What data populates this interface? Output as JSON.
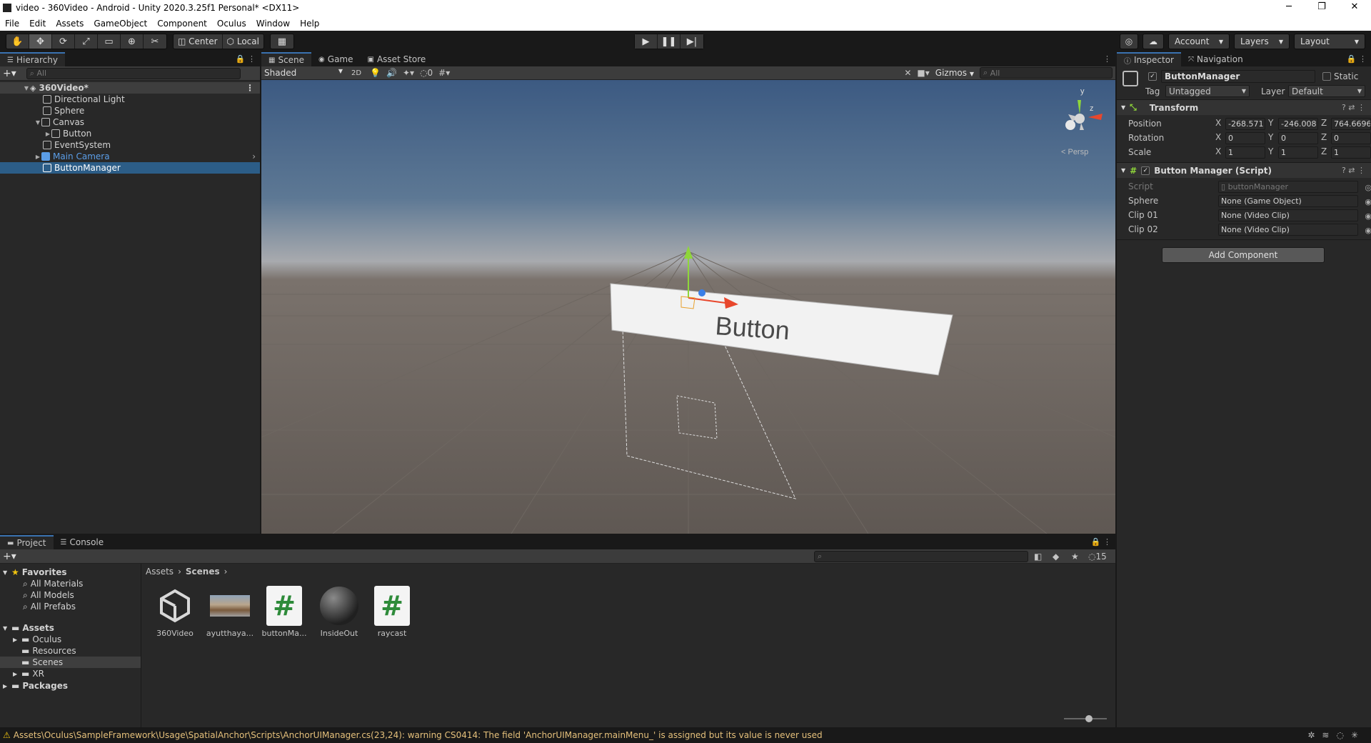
{
  "window": {
    "title": "video - 360Video - Android - Unity 2020.3.25f1 Personal* <DX11>",
    "minimize": "─",
    "maximize": "❐",
    "close": "✕"
  },
  "menu": [
    "File",
    "Edit",
    "Assets",
    "GameObject",
    "Component",
    "Oculus",
    "Window",
    "Help"
  ],
  "toolbar": {
    "tools": [
      "hand-icon",
      "move-icon",
      "rotate-icon",
      "scale-icon",
      "rect-icon",
      "transform-icon",
      "custom-tool-icon"
    ],
    "pivot": "Center",
    "space": "Local",
    "account": "Account",
    "layers": "Layers",
    "layout": "Layout"
  },
  "hierarchy": {
    "tab": "Hierarchy",
    "search_placeholder": "All",
    "items": [
      {
        "label": "360Video*",
        "depth": 0,
        "type": "scene"
      },
      {
        "label": "Directional Light",
        "depth": 1
      },
      {
        "label": "Sphere",
        "depth": 1
      },
      {
        "label": "Canvas",
        "depth": 1
      },
      {
        "label": "Button",
        "depth": 2
      },
      {
        "label": "EventSystem",
        "depth": 1
      },
      {
        "label": "Main Camera",
        "depth": 1,
        "type": "prefab"
      },
      {
        "label": "ButtonManager",
        "depth": 1,
        "selected": true
      }
    ]
  },
  "scene": {
    "tabs": [
      "Scene",
      "Game",
      "Asset Store"
    ],
    "shading": "Shaded",
    "mode2d": "2D",
    "hidden_count": "0",
    "gizmos": "Gizmos",
    "search_placeholder": "All",
    "button_text": "Button",
    "persp": "< Persp",
    "axis_y": "y",
    "axis_z": "z"
  },
  "inspector": {
    "tabs": [
      "Inspector",
      "Navigation"
    ],
    "object_name": "ButtonManager",
    "static": "Static",
    "tag_label": "Tag",
    "tag": "Untagged",
    "layer_label": "Layer",
    "layer": "Default",
    "transform": {
      "title": "Transform",
      "position": {
        "label": "Position",
        "x": "-268.571",
        "y": "-246.008",
        "z": "764.6696"
      },
      "rotation": {
        "label": "Rotation",
        "x": "0",
        "y": "0",
        "z": "0"
      },
      "scale": {
        "label": "Scale",
        "x": "1",
        "y": "1",
        "z": "1"
      }
    },
    "script_comp": {
      "title": "Button Manager (Script)",
      "script_label": "Script",
      "script_value": "buttonManager",
      "fields": [
        {
          "label": "Sphere",
          "value": "None (Game Object)"
        },
        {
          "label": "Clip 01",
          "value": "None (Video Clip)"
        },
        {
          "label": "Clip 02",
          "value": "None (Video Clip)"
        }
      ]
    },
    "add_component": "Add Component"
  },
  "project": {
    "tabs": [
      "Project",
      "Console"
    ],
    "hidden_count": "15",
    "favorites": {
      "label": "Favorites",
      "items": [
        "All Materials",
        "All Models",
        "All Prefabs"
      ]
    },
    "assets": {
      "label": "Assets",
      "items": [
        "Oculus",
        "Resources",
        "Scenes",
        "XR"
      ]
    },
    "packages": "Packages",
    "breadcrumb": [
      "Assets",
      "Scenes"
    ],
    "files": [
      {
        "name": "360Video",
        "kind": "unity-scene-icon"
      },
      {
        "name": "ayutthaya...",
        "kind": "texture-thumbnail"
      },
      {
        "name": "buttonMa...",
        "kind": "csharp-script-icon"
      },
      {
        "name": "InsideOut",
        "kind": "material-sphere-icon"
      },
      {
        "name": "raycast",
        "kind": "csharp-script-icon"
      }
    ]
  },
  "status": {
    "message": "Assets\\Oculus\\SampleFramework\\Usage\\SpatialAnchor\\Scripts\\AnchorUIManager.cs(23,24): warning CS0414: The field 'AnchorUIManager.mainMenu_' is assigned but its value is never used"
  },
  "colors": {
    "selection": "#2c5d87",
    "accent_tab": "#3a72b0",
    "warning": "#e5c07b",
    "prefab": "#5b9ee8"
  }
}
